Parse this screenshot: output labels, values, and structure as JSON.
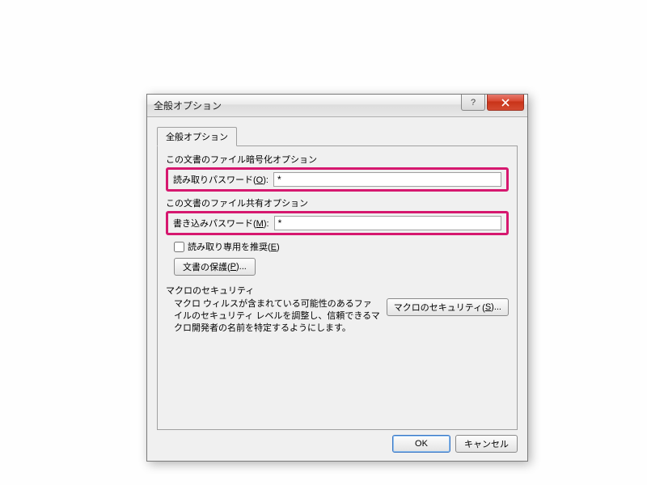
{
  "titlebar": {
    "title": "全般オプション"
  },
  "tabs": {
    "general": "全般オプション"
  },
  "sections": {
    "encryption_label": "この文書のファイル暗号化オプション",
    "read_password_label": "読み取りパスワード(O):",
    "read_password_value": "*",
    "sharing_label": "この文書のファイル共有オプション",
    "write_password_label": "書き込みパスワード(M):",
    "write_password_value": "*",
    "readonly_recommended_label": "読み取り専用を推奨(E)",
    "protect_document_label": "文書の保護(P)...",
    "macro_section_label": "マクロのセキュリティ",
    "macro_description": "マクロ ウィルスが含まれている可能性のあるファイルのセキュリティ レベルを調整し、信頼できるマクロ開発者の名前を特定するようにします。",
    "macro_button_label": "マクロのセキュリティ(S)..."
  },
  "footer": {
    "ok_label": "OK",
    "cancel_label": "キャンセル"
  }
}
